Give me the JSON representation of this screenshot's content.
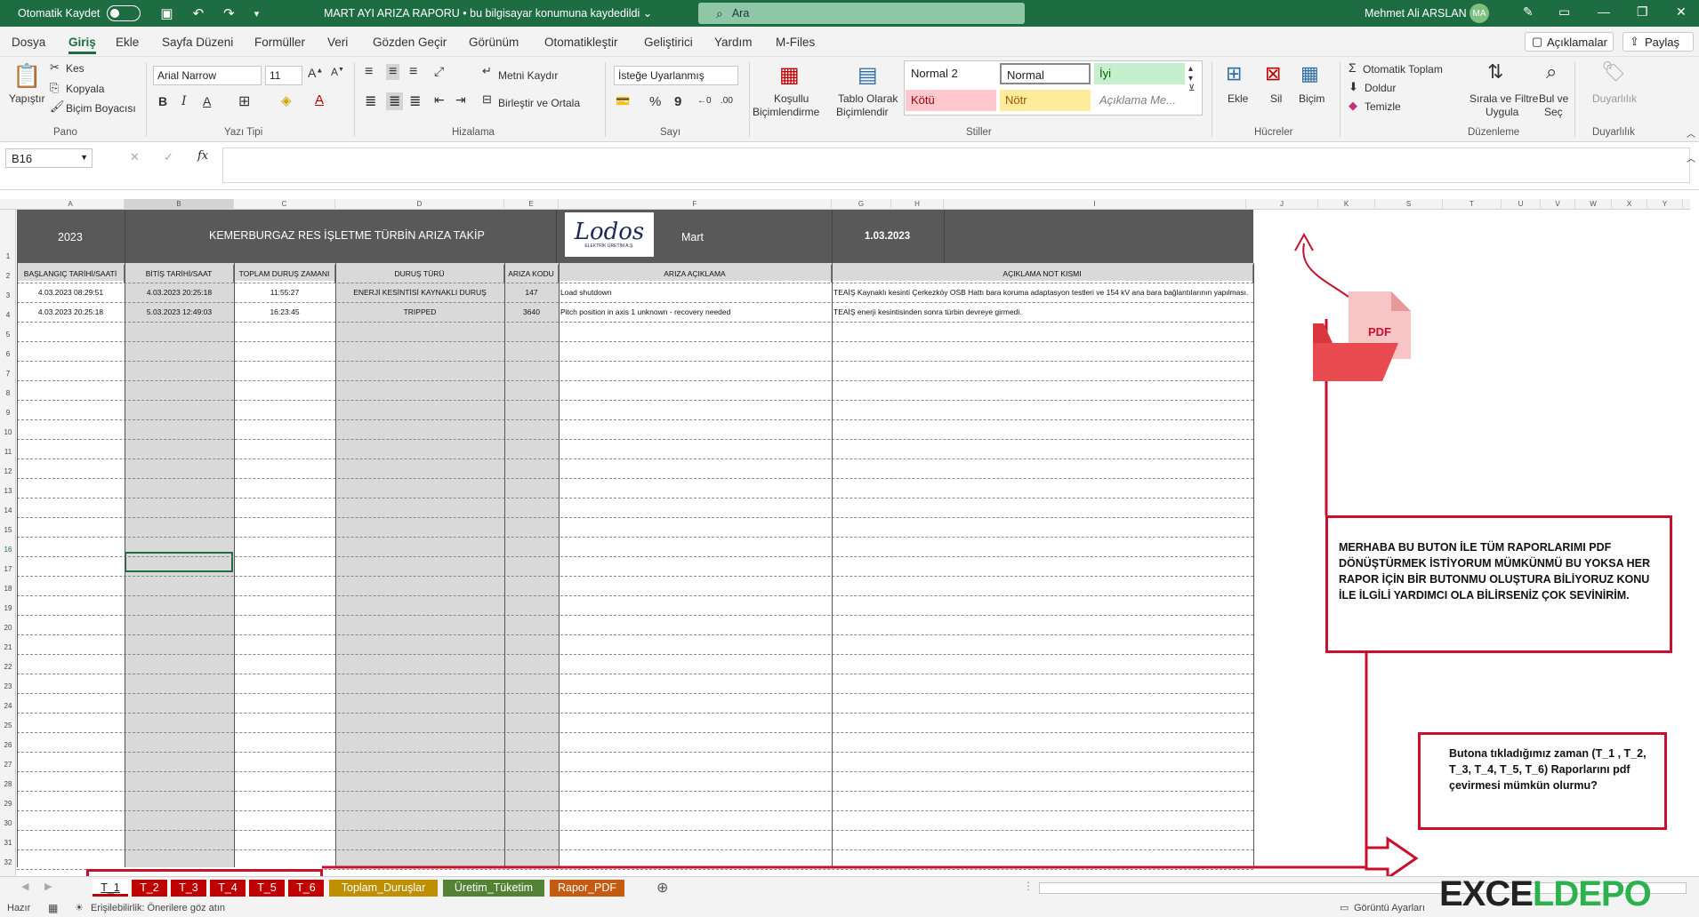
{
  "titlebar": {
    "autosave_label": "Otomatik Kaydet",
    "document_title": "MART AYI ARIZA RAPORU • bu bilgisayar konumuna kaydedildi ⌄",
    "search_placeholder": "Ara",
    "user_name": "Mehmet Ali ARSLAN",
    "user_initials": "MA"
  },
  "ribbon_tabs": [
    "Dosya",
    "Giriş",
    "Ekle",
    "Sayfa Düzeni",
    "Formüller",
    "Veri",
    "Gözden Geçir",
    "Görünüm",
    "Otomatikleştir",
    "Geliştirici",
    "Yardım",
    "M-Files"
  ],
  "ribbon_buttons": {
    "comments": "Açıklamalar",
    "share": "Paylaş"
  },
  "ribbon": {
    "paste": "Yapıştır",
    "cut": "Kes",
    "copy": "Kopyala",
    "format_painter": "Biçim Boyacısı",
    "clipboard_group": "Pano",
    "font_name": "Arial Narrow",
    "font_size": "11",
    "font_group": "Yazı Tipi",
    "wrap_text": "Metni Kaydır",
    "merge_center": "Birleştir ve Ortala",
    "alignment_group": "Hizalama",
    "number_format": "İsteğe Uyarlanmış",
    "number_group": "Sayı",
    "conditional_format_1": "Koşullu",
    "conditional_format_2": "Biçimlendirme",
    "format_table_1": "Tablo Olarak",
    "format_table_2": "Biçimlendir",
    "styles_group": "Stiller",
    "style_normal2": "Normal 2",
    "style_normal": "Normal",
    "style_good": "İyi",
    "style_bad": "Kötü",
    "style_neutral": "Nötr",
    "style_explanatory": "Açıklama Me...",
    "insert": "Ekle",
    "delete": "Sil",
    "format": "Biçim",
    "cells_group": "Hücreler",
    "autosum": "Otomatik Toplam",
    "fill": "Doldur",
    "clear": "Temizle",
    "sort_filter_1": "Sırala ve Filtre",
    "sort_filter_2": "Uygula",
    "find_select_1": "Bul ve",
    "find_select_2": "Seç",
    "editing_group": "Düzenleme",
    "sensitivity": "Duyarlılık",
    "sensitivity_group": "Duyarlılık"
  },
  "formula_bar": {
    "name_box": "B16",
    "fx": "fx"
  },
  "columns": [
    "A",
    "B",
    "C",
    "D",
    "E",
    "F",
    "G",
    "H",
    "I",
    "J",
    "K",
    "S",
    "T",
    "U",
    "V",
    "W",
    "X",
    "Y"
  ],
  "rows": [
    "1",
    "2",
    "3",
    "4",
    "5",
    "6",
    "7",
    "8",
    "9",
    "10",
    "11",
    "12",
    "13",
    "14",
    "15",
    "16",
    "17",
    "18",
    "19",
    "20",
    "21",
    "22",
    "23",
    "24",
    "25",
    "26",
    "27",
    "28",
    "29",
    "30",
    "31",
    "32",
    "33"
  ],
  "sheet": {
    "year": "2023",
    "title": "KEMERBURGAZ RES İŞLETME TÜRBİN ARIZA TAKİP",
    "logo_text": "Lodos",
    "logo_subtext": "ELEKTRİK ÜRETİM A.Ş.",
    "month": "Mart",
    "date": "1.03.2023",
    "headers": [
      "BAŞLANGIÇ TARİHİ/SAATİ",
      "BİTİŞ TARİHİ/SAAT",
      "TOPLAM DURUŞ ZAMANI",
      "DURUŞ TÜRÜ",
      "ARIZA KODU",
      "ARIZA AÇIKLAMA",
      "AÇIKLAMA NOT KISMI"
    ],
    "data_rows": [
      [
        "4.03.2023 08:29:51",
        "4.03.2023 20:25:18",
        "11:55:27",
        "ENERJİ KESİNTİSİ KAYNAKLI DURUŞ",
        "147",
        "Load shutdown",
        "TEAİŞ Kaynaklı kesinti Çerkezköy OSB Hattı bara koruma adaptasyon testleri ve 154 kV ana bara bağlantılarının yapılması."
      ],
      [
        "4.03.2023 20:25:18",
        "5.03.2023 12:49:03",
        "16:23:45",
        "TRIPPED",
        "3640",
        "Pitch position in axis 1 unknown - recovery needed",
        "TEAİŞ enerji kesintisinden sonra türbin devreye girmedi."
      ]
    ]
  },
  "pdf_icon_label": "PDF",
  "notes": {
    "note1": "MERHABA BU BUTON İLE TÜM RAPORLARIMI PDF DÖNÜŞTÜRMEK İSTİYORUM MÜMKÜNMÜ BU YOKSA HER RAPOR İÇİN BİR BUTONMU OLUŞTURA BİLİYORUZ KONU İLE İLGİLİ YARDIMCI OLA BİLİRSENİZ ÇOK SEVİNİRİM.",
    "note2": "Butona tıkladığımız zaman (T_1 , T_2, T_3, T_4, T_5, T_6) Raporlarını pdf çevirmesi mümkün olurmu?"
  },
  "sheet_tabs": [
    {
      "label": "T_1",
      "color": "#c00000"
    },
    {
      "label": "T_2",
      "color": "#c00000"
    },
    {
      "label": "T_3",
      "color": "#c00000"
    },
    {
      "label": "T_4",
      "color": "#c00000"
    },
    {
      "label": "T_5",
      "color": "#c00000"
    },
    {
      "label": "T_6",
      "color": "#c00000"
    },
    {
      "label": "Toplam_Duruşlar",
      "color": "#bf8f00"
    },
    {
      "label": "Üretim_Tüketim",
      "color": "#548235"
    },
    {
      "label": "Rapor_PDF",
      "color": "#c55a11"
    }
  ],
  "status": {
    "ready": "Hazır",
    "accessibility": "Erişilebilirlik: Önerilere göz atın",
    "display_settings": "Görüntü Ayarları"
  },
  "watermark": "EXCELDEPO",
  "colors": {
    "excel_green": "#1e6c41",
    "header_dark": "#595959",
    "annotation_red": "#c8102e"
  }
}
